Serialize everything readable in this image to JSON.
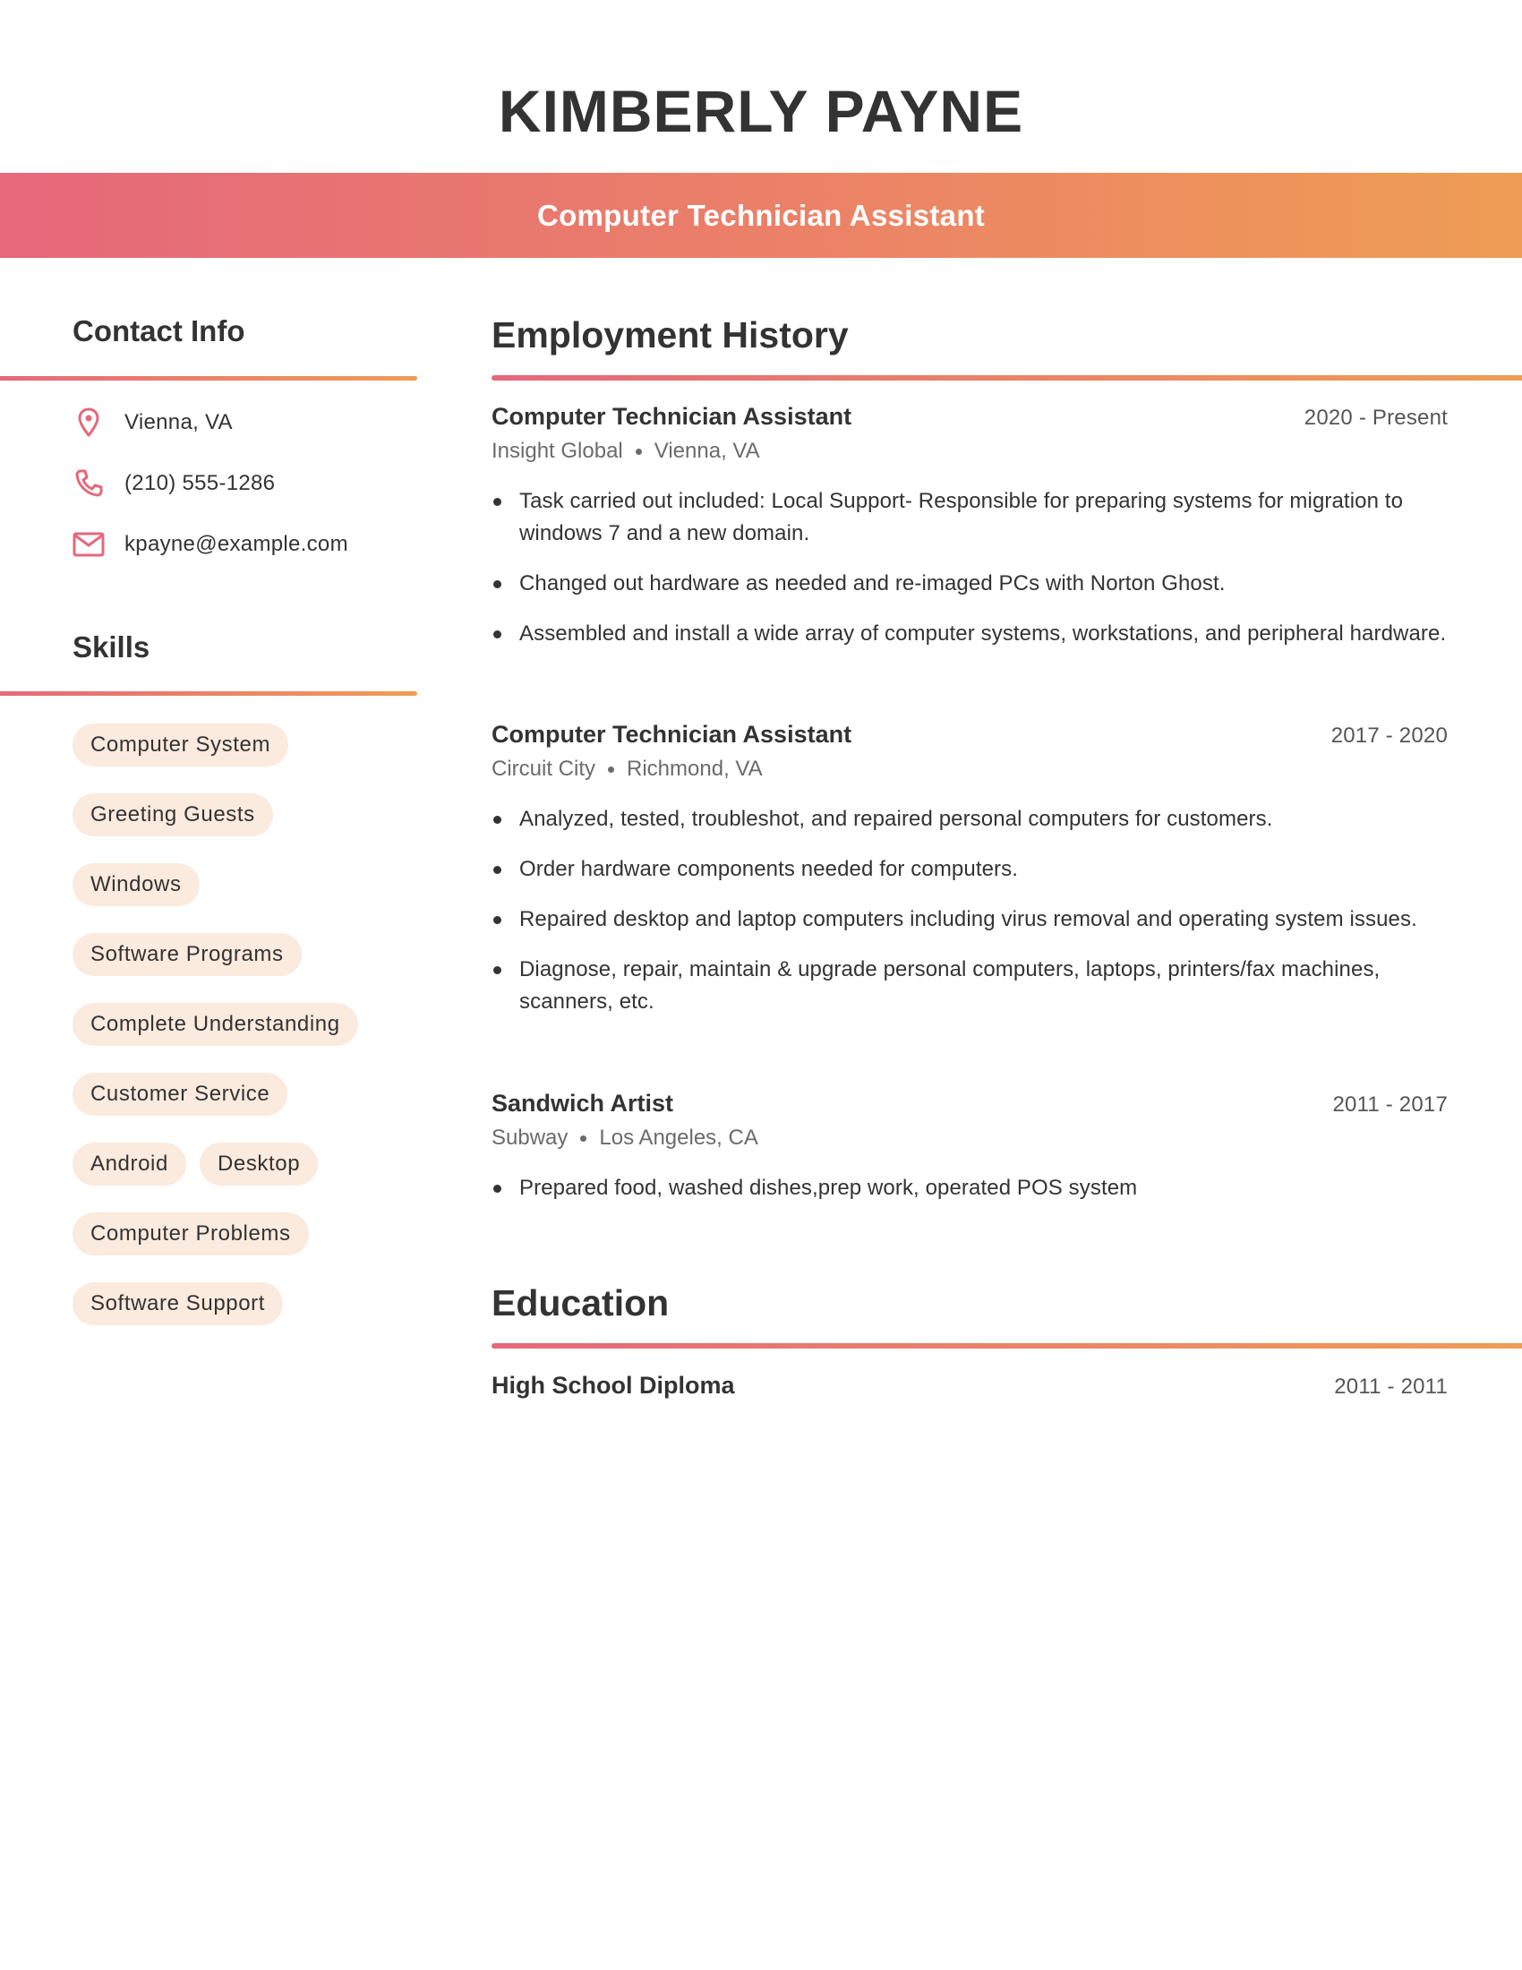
{
  "header": {
    "name": "KIMBERLY PAYNE",
    "title": "Computer Technician Assistant"
  },
  "colors": {
    "gradient_start": "#E5687B",
    "gradient_end": "#EF9D55",
    "icon": "#E5687B",
    "chip_background": "#FBEADE",
    "text": "#333333"
  },
  "contact": {
    "heading": "Contact Info",
    "items": [
      {
        "icon": "map-pin-icon",
        "text": "Vienna, VA"
      },
      {
        "icon": "phone-icon",
        "text": "(210) 555-1286"
      },
      {
        "icon": "mail-icon",
        "text": "kpayne@example.com"
      }
    ]
  },
  "skills": {
    "heading": "Skills",
    "items": [
      "Computer System",
      "Greeting Guests",
      "Windows",
      "Software Programs",
      "Complete Understanding",
      "Customer Service",
      "Android",
      "Desktop",
      "Computer Problems",
      "Software Support"
    ]
  },
  "employment": {
    "heading": "Employment History",
    "jobs": [
      {
        "title": "Computer Technician Assistant",
        "dates": "2020 - Present",
        "company": "Insight Global",
        "location": "Vienna, VA",
        "bullets": [
          "Task carried out included: Local Support- Responsible for preparing systems for migration to windows 7 and a new domain.",
          "Changed out hardware as needed and re-imaged PCs with Norton Ghost.",
          "Assembled and install a wide array of computer systems, workstations, and peripheral hardware."
        ]
      },
      {
        "title": "Computer Technician Assistant",
        "dates": "2017 - 2020",
        "company": "Circuit City",
        "location": "Richmond, VA",
        "bullets": [
          "Analyzed, tested, troubleshot, and repaired personal computers for customers.",
          "Order hardware components needed for computers.",
          "Repaired desktop and laptop computers including virus removal and operating system issues.",
          "Diagnose, repair, maintain & upgrade personal computers, laptops, printers/fax machines, scanners, etc."
        ]
      },
      {
        "title": "Sandwich Artist",
        "dates": "2011 - 2017",
        "company": "Subway",
        "location": "Los Angeles, CA",
        "bullets": [
          "Prepared food, washed dishes,prep work, operated POS system"
        ]
      }
    ]
  },
  "education": {
    "heading": "Education",
    "items": [
      {
        "degree": "High School Diploma",
        "dates": "2011 - 2011"
      }
    ]
  }
}
